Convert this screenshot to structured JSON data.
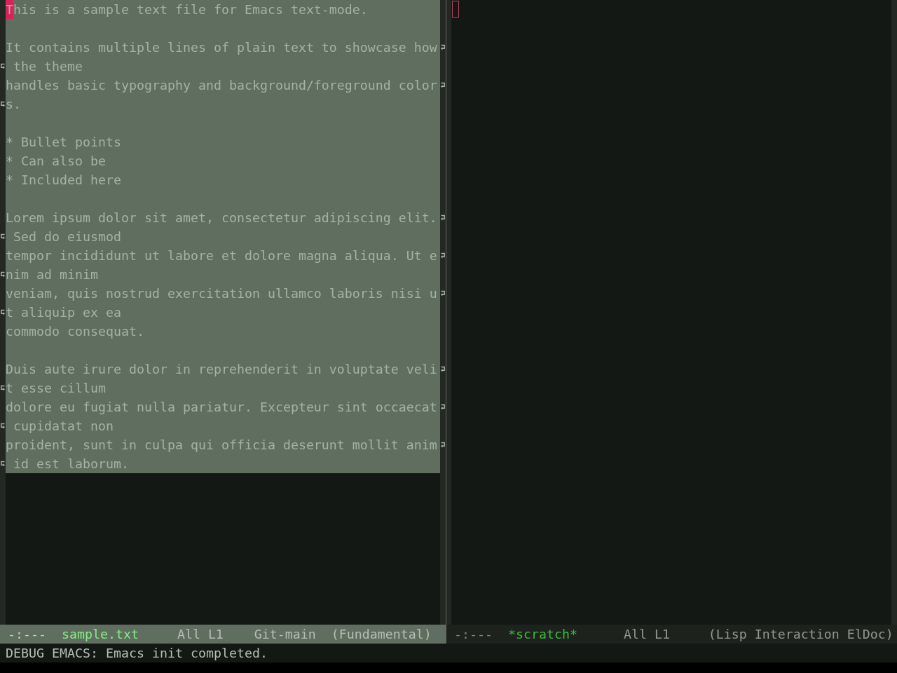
{
  "windows": [
    {
      "selected": true,
      "region_active": true,
      "lines": [
        {
          "kind": "text",
          "segments": [
            "This is a sample text file for Emacs text-mode."
          ]
        },
        {
          "kind": "blank"
        },
        {
          "kind": "text",
          "segments": [
            "It contains multiple lines of plain text to showcase how",
            " the theme"
          ]
        },
        {
          "kind": "text",
          "segments": [
            "handles basic typography and background/foreground color",
            "s."
          ]
        },
        {
          "kind": "blank"
        },
        {
          "kind": "text",
          "segments": [
            "* Bullet points"
          ]
        },
        {
          "kind": "text",
          "segments": [
            "* Can also be"
          ]
        },
        {
          "kind": "text",
          "segments": [
            "* Included here"
          ]
        },
        {
          "kind": "blank"
        },
        {
          "kind": "text",
          "segments": [
            "Lorem ipsum dolor sit amet, consectetur adipiscing elit.",
            " Sed do eiusmod"
          ]
        },
        {
          "kind": "text",
          "segments": [
            "tempor incididunt ut labore et dolore magna aliqua. Ut e",
            "nim ad minim"
          ]
        },
        {
          "kind": "text",
          "segments": [
            "veniam, quis nostrud exercitation ullamco laboris nisi u",
            "t aliquip ex ea"
          ]
        },
        {
          "kind": "text",
          "segments": [
            "commodo consequat."
          ]
        },
        {
          "kind": "blank"
        },
        {
          "kind": "text",
          "segments": [
            "Duis aute irure dolor in reprehenderit in voluptate veli",
            "t esse cillum"
          ]
        },
        {
          "kind": "text",
          "segments": [
            "dolore eu fugiat nulla pariatur. Excepteur sint occaecat",
            " cupidatat non"
          ]
        },
        {
          "kind": "text",
          "segments": [
            "proident, sunt in culpa qui officia deserunt mollit anim",
            " id est laborum."
          ]
        }
      ],
      "mode_line": {
        "status": "-:---",
        "buffer_name": "sample.txt",
        "position": "All L1",
        "vc": "Git-main",
        "modes": "(Fundamental)"
      }
    },
    {
      "selected": false,
      "mode_line": {
        "status": "-:---",
        "buffer_name": "*scratch*",
        "position": "All L1",
        "modes": "(Lisp Interaction ElDoc)"
      }
    }
  ],
  "echo_area": "DEBUG EMACS: Emacs init completed."
}
